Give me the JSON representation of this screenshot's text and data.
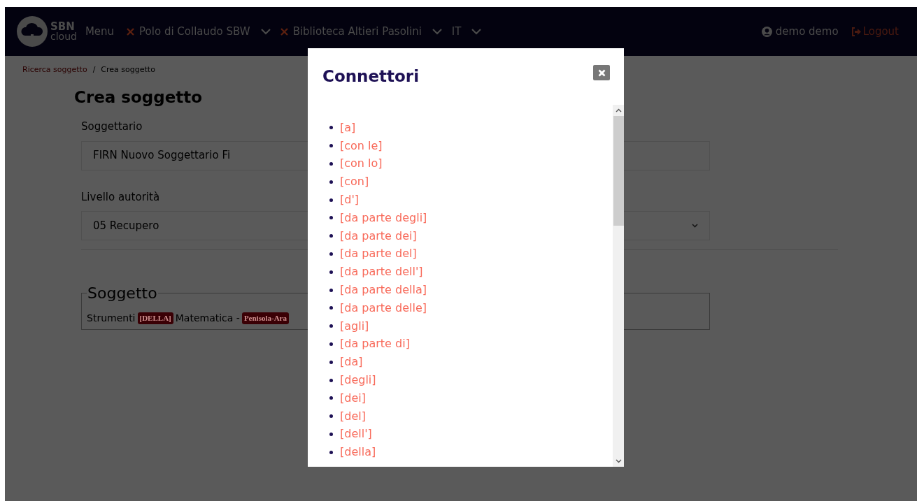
{
  "navbar": {
    "logo": {
      "top": "SBN",
      "bottom": "cloud"
    },
    "menu": "Menu",
    "contexts": [
      {
        "label": "Polo di Collaudo SBW",
        "removable": true
      },
      {
        "label": "Biblioteca Altieri Pasolini",
        "removable": true
      },
      {
        "label": "IT",
        "removable": false
      }
    ],
    "user": "demo demo",
    "logout": "Logout"
  },
  "breadcrumb_separator": "/",
  "breadcrumb": [
    {
      "label": "Ricerca soggetto",
      "link": true
    },
    {
      "label": "Crea soggetto",
      "link": false
    }
  ],
  "page": {
    "title": "Crea soggetto",
    "fields": [
      {
        "kind": "text",
        "label": "Soggettario",
        "value": "FIRN Nuovo Soggettario Fi"
      },
      {
        "kind": "select",
        "label": "Livello autorità",
        "value": "05 Recupero"
      }
    ],
    "soggetto": {
      "legend": "Soggetto",
      "parts": [
        {
          "kind": "text",
          "text": "Strumenti"
        },
        {
          "kind": "tag",
          "text": "[DELLA]"
        },
        {
          "kind": "text",
          "text": "Matematica -"
        },
        {
          "kind": "tag",
          "text": "Penisola-Ara"
        }
      ]
    }
  },
  "modal": {
    "title": "Connettori",
    "items": [
      "[a]",
      "[con le]",
      "[con lo]",
      "[con]",
      "[d']",
      "[da parte degli]",
      "[da parte dei]",
      "[da parte del]",
      "[da parte dell']",
      "[da parte della]",
      "[da parte delle]",
      "[agli]",
      "[da parte di]",
      "[da]",
      "[degli]",
      "[dei]",
      "[del]",
      "[dell']",
      "[della]"
    ]
  }
}
